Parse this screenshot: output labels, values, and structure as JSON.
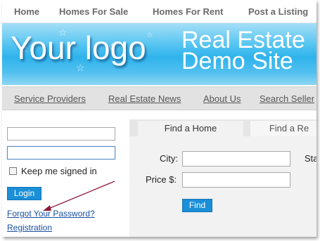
{
  "topnav": {
    "items": [
      "Home",
      "Homes For Sale",
      "Homes For Rent",
      "Post a Listing"
    ]
  },
  "banner": {
    "logo": "Your logo",
    "title_line1": "Real Estate",
    "title_line2": "Demo Site"
  },
  "subnav": {
    "items": [
      "Service Providers",
      "Real Estate News",
      "About Us",
      "Search Seller"
    ]
  },
  "login": {
    "username_value": "",
    "password_value": "",
    "keep_signed_in_label": "Keep me signed in",
    "login_button": "Login",
    "forgot_link": "Forgot Your Password?",
    "registration_link": "Registration"
  },
  "search": {
    "tabs": [
      "Find a Home",
      "Find a Re"
    ],
    "city_label": "City:",
    "state_label": "Sta",
    "price_label": "Price $:",
    "find_button": "Find"
  },
  "colors": {
    "accent": "#1b8fd8",
    "banner": "#2fb3ec",
    "arrow": "#8b1a3a"
  }
}
